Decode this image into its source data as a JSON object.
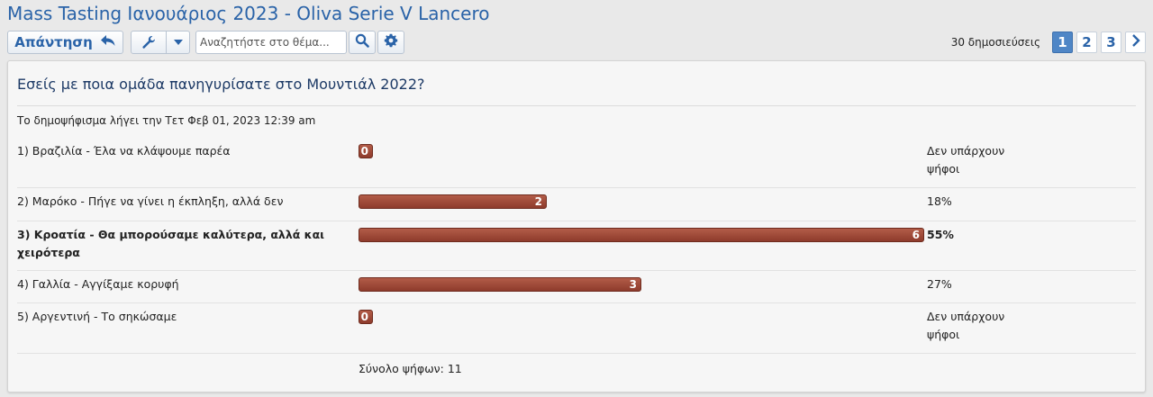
{
  "thread": {
    "title": "Mass Tasting Ιανουάριος 2023 - Oliva Serie V Lancero"
  },
  "toolbar": {
    "reply_label": "Απάντηση",
    "reply_icon": "reply-arrow-icon",
    "tools_icon": "wrench-icon",
    "search_placeholder": "Αναζητήστε στο θέμα...",
    "search_icon": "search-icon",
    "advanced_icon": "gear-icon"
  },
  "pagination": {
    "post_count": "30 δημοσιεύσεις",
    "pages": [
      "1",
      "2",
      "3"
    ],
    "current_page": "1",
    "next_icon": "chevron-right-icon"
  },
  "poll": {
    "question": "Εσείς με ποια ομάδα πανηγυρίσατε στο Μουντιάλ 2022?",
    "deadline": "Το δημοψήφισμα λήγει την Τετ Φεβ 01, 2023 12:39 am",
    "total": "Σύνολο ψήφων: 11",
    "max_votes": 6,
    "bar_color": "#a04a38",
    "options": [
      {
        "label": "1) Βραζιλία - Έλα να κλάψουμε παρέα",
        "votes": 0,
        "votes_text": "0",
        "result": "Δεν υπάρχουν ψήφοι",
        "bold": false
      },
      {
        "label": "2) Μαρόκο - Πήγε να γίνει η έκπληξη, αλλά δεν",
        "votes": 2,
        "votes_text": "2",
        "result": "18%",
        "bold": false
      },
      {
        "label": "3) Κροατία - Θα μπορούσαμε καλύτερα, αλλά και χειρότερα",
        "votes": 6,
        "votes_text": "6",
        "result": "55%",
        "bold": true
      },
      {
        "label": "4) Γαλλία - Αγγίξαμε κορυφή",
        "votes": 3,
        "votes_text": "3",
        "result": "27%",
        "bold": false
      },
      {
        "label": "5) Αργεντινή - Το σηκώσαμε",
        "votes": 0,
        "votes_text": "0",
        "result": "Δεν υπάρχουν ψήφοι",
        "bold": false
      }
    ]
  }
}
